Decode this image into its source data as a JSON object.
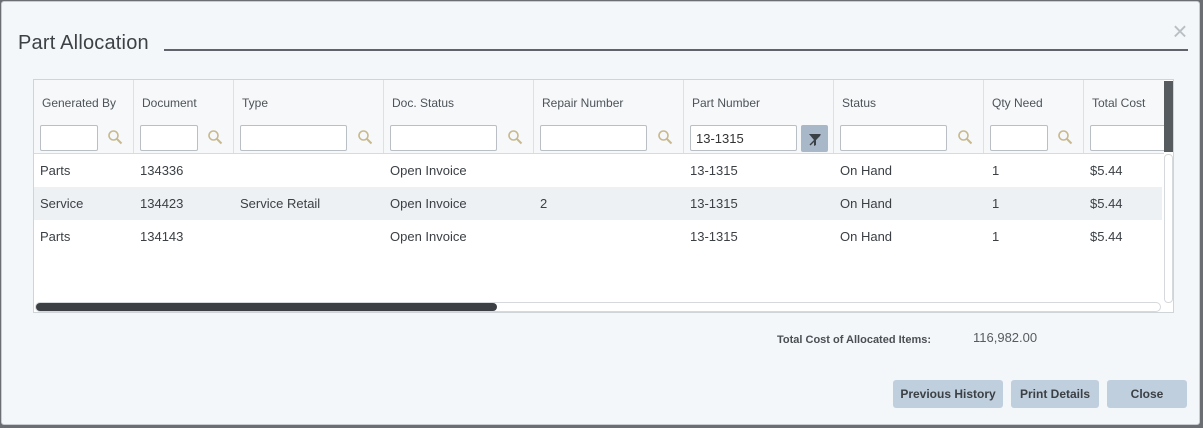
{
  "dialog": {
    "title": "Part Allocation",
    "close_glyph": "×"
  },
  "grid": {
    "columns": [
      {
        "label": "Generated By",
        "filter_value": ""
      },
      {
        "label": "Document",
        "filter_value": ""
      },
      {
        "label": "Type",
        "filter_value": ""
      },
      {
        "label": "Doc. Status",
        "filter_value": ""
      },
      {
        "label": "Repair Number",
        "filter_value": ""
      },
      {
        "label": "Part Number",
        "filter_value": "13-1315"
      },
      {
        "label": "Status",
        "filter_value": ""
      },
      {
        "label": "Qty Need",
        "filter_value": ""
      },
      {
        "label": "Total Cost",
        "filter_value": ""
      }
    ],
    "rows": [
      [
        "Parts",
        "134336",
        "",
        "Open Invoice",
        "",
        "13-1315",
        "On Hand",
        "1",
        "$5.44"
      ],
      [
        "Service",
        "134423",
        "Service Retail",
        "Open Invoice",
        "2",
        "13-1315",
        "On Hand",
        "1",
        "$5.44"
      ],
      [
        "Parts",
        "134143",
        "",
        "Open Invoice",
        "",
        "13-1315",
        "On Hand",
        "1",
        "$5.44"
      ]
    ],
    "horizontal_scroll_fraction": 0.41
  },
  "summary": {
    "total_label": "Total Cost of Allocated Items:",
    "total_value": "116,982.00"
  },
  "buttons": {
    "previous_history": "Previous History",
    "print_details": "Print Details",
    "close": "Close"
  },
  "icons": {
    "filter_search": "magnifier-icon",
    "clear_filter": "funnel-clear-icon",
    "close_dialog": "close-icon"
  }
}
